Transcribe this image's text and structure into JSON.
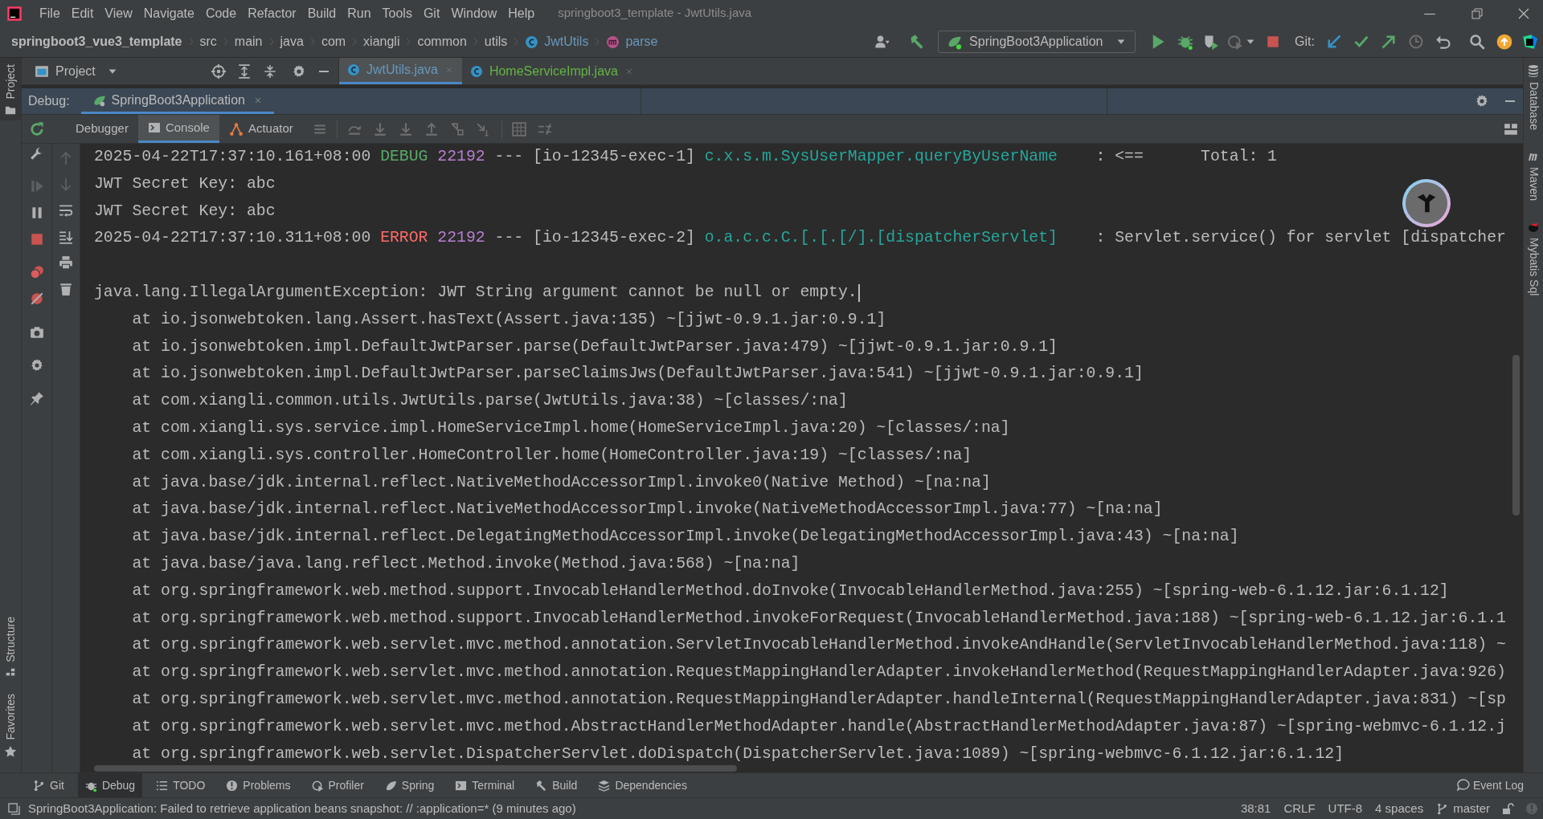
{
  "window": {
    "title": "springboot3_template - JwtUtils.java"
  },
  "menu": [
    "File",
    "Edit",
    "View",
    "Navigate",
    "Code",
    "Refactor",
    "Build",
    "Run",
    "Tools",
    "Git",
    "Window",
    "Help"
  ],
  "breadcrumbs": [
    {
      "label": "springboot3_vue3_template",
      "kind": "project"
    },
    {
      "label": "src",
      "kind": "folder"
    },
    {
      "label": "main",
      "kind": "folder"
    },
    {
      "label": "java",
      "kind": "folder"
    },
    {
      "label": "com",
      "kind": "folder"
    },
    {
      "label": "xiangli",
      "kind": "folder"
    },
    {
      "label": "common",
      "kind": "folder"
    },
    {
      "label": "utils",
      "kind": "folder"
    },
    {
      "label": "JwtUtils",
      "kind": "class"
    },
    {
      "label": "parse",
      "kind": "method"
    }
  ],
  "toolbar": {
    "run_config": "SpringBoot3Application",
    "git_label": "Git:"
  },
  "project_panel": {
    "title": "Project"
  },
  "editor_tabs": [
    {
      "label": "JwtUtils.java",
      "selected": true,
      "color": "#6897bb"
    },
    {
      "label": "HomeServiceImpl.java",
      "selected": false,
      "color": "#62b543"
    }
  ],
  "left_stripe": {
    "top": [
      "Project"
    ],
    "bottom": [
      "Structure",
      "Favorites"
    ]
  },
  "right_stripe": [
    "Database",
    "Maven",
    "Mybatis Sql"
  ],
  "debug": {
    "label": "Debug:",
    "sessions": [
      {
        "label": "SpringBoot3Application",
        "selected": true
      }
    ],
    "tabs": [
      {
        "label": "Debugger",
        "selected": false,
        "kind": "debugger"
      },
      {
        "label": "Console",
        "selected": true,
        "kind": "console"
      },
      {
        "label": "Actuator",
        "selected": false,
        "kind": "actuator"
      }
    ]
  },
  "console": {
    "lines": [
      {
        "kind": "log",
        "segments": [
          {
            "kind": "text",
            "text": "2025-04-22T17:37:10.161+08:00 "
          },
          {
            "kind": "debug",
            "text": "DEBUG"
          },
          {
            "kind": "pid",
            "text": " 22192"
          },
          {
            "kind": "text",
            "text": " --- [io-12345-exec-1] "
          },
          {
            "kind": "logger",
            "text": "c.x.s.m.SysUserMapper.queryByUserName"
          },
          {
            "kind": "text",
            "text": "    : <==      Total: 1"
          }
        ]
      },
      {
        "kind": "plain",
        "text": "JWT Secret Key: abc"
      },
      {
        "kind": "plain",
        "text": "JWT Secret Key: abc"
      },
      {
        "kind": "log",
        "segments": [
          {
            "kind": "text",
            "text": "2025-04-22T17:37:10.311+08:00 "
          },
          {
            "kind": "error",
            "text": "ERROR"
          },
          {
            "kind": "pid",
            "text": " 22192"
          },
          {
            "kind": "text",
            "text": " --- [io-12345-exec-2] "
          },
          {
            "kind": "logger",
            "text": "o.a.c.c.C.[.[.[/].[dispatcherServlet]"
          },
          {
            "kind": "text",
            "text": "    : Servlet.service() for servlet [dispatcher"
          }
        ]
      },
      {
        "kind": "blank"
      },
      {
        "kind": "plain",
        "text": "java.lang.IllegalArgumentException: JWT String argument cannot be null or empty.",
        "cursor": true
      },
      {
        "kind": "stack",
        "text": "at io.jsonwebtoken.lang.Assert.hasText(Assert.java:135) ~[jjwt-0.9.1.jar:0.9.1]"
      },
      {
        "kind": "stack",
        "text": "at io.jsonwebtoken.impl.DefaultJwtParser.parse(DefaultJwtParser.java:479) ~[jjwt-0.9.1.jar:0.9.1]"
      },
      {
        "kind": "stack",
        "text": "at io.jsonwebtoken.impl.DefaultJwtParser.parseClaimsJws(DefaultJwtParser.java:541) ~[jjwt-0.9.1.jar:0.9.1]"
      },
      {
        "kind": "stack",
        "text": "at com.xiangli.common.utils.JwtUtils.parse(JwtUtils.java:38) ~[classes/:na]"
      },
      {
        "kind": "stack",
        "text": "at com.xiangli.sys.service.impl.HomeServiceImpl.home(HomeServiceImpl.java:20) ~[classes/:na]"
      },
      {
        "kind": "stack",
        "text": "at com.xiangli.sys.controller.HomeController.home(HomeController.java:19) ~[classes/:na]"
      },
      {
        "kind": "stack",
        "text": "at java.base/jdk.internal.reflect.NativeMethodAccessorImpl.invoke0(Native Method) ~[na:na]"
      },
      {
        "kind": "stack",
        "text": "at java.base/jdk.internal.reflect.NativeMethodAccessorImpl.invoke(NativeMethodAccessorImpl.java:77) ~[na:na]"
      },
      {
        "kind": "stack",
        "text": "at java.base/jdk.internal.reflect.DelegatingMethodAccessorImpl.invoke(DelegatingMethodAccessorImpl.java:43) ~[na:na]"
      },
      {
        "kind": "stack",
        "text": "at java.base/java.lang.reflect.Method.invoke(Method.java:568) ~[na:na]"
      },
      {
        "kind": "stack",
        "text": "at org.springframework.web.method.support.InvocableHandlerMethod.doInvoke(InvocableHandlerMethod.java:255) ~[spring-web-6.1.12.jar:6.1.12]"
      },
      {
        "kind": "stack",
        "text": "at org.springframework.web.method.support.InvocableHandlerMethod.invokeForRequest(InvocableHandlerMethod.java:188) ~[spring-web-6.1.12.jar:6.1.1"
      },
      {
        "kind": "stack",
        "text": "at org.springframework.web.servlet.mvc.method.annotation.ServletInvocableHandlerMethod.invokeAndHandle(ServletInvocableHandlerMethod.java:118) ~"
      },
      {
        "kind": "stack",
        "text": "at org.springframework.web.servlet.mvc.method.annotation.RequestMappingHandlerAdapter.invokeHandlerMethod(RequestMappingHandlerAdapter.java:926)"
      },
      {
        "kind": "stack",
        "text": "at org.springframework.web.servlet.mvc.method.annotation.RequestMappingHandlerAdapter.handleInternal(RequestMappingHandlerAdapter.java:831) ~[sp"
      },
      {
        "kind": "stack",
        "text": "at org.springframework.web.servlet.mvc.method.AbstractHandlerMethodAdapter.handle(AbstractHandlerMethodAdapter.java:87) ~[spring-webmvc-6.1.12.j"
      },
      {
        "kind": "stack",
        "text": "at org.springframework.web.servlet.DispatcherServlet.doDispatch(DispatcherServlet.java:1089) ~[spring-webmvc-6.1.12.jar:6.1.12]"
      }
    ]
  },
  "tool_windows": [
    {
      "label": "Git",
      "selected": false,
      "kind": "git"
    },
    {
      "label": "Debug",
      "selected": true,
      "kind": "debug"
    },
    {
      "label": "TODO",
      "selected": false,
      "kind": "todo"
    },
    {
      "label": "Problems",
      "selected": false,
      "kind": "problems"
    },
    {
      "label": "Profiler",
      "selected": false,
      "kind": "profiler"
    },
    {
      "label": "Spring",
      "selected": false,
      "kind": "spring"
    },
    {
      "label": "Terminal",
      "selected": false,
      "kind": "terminal"
    },
    {
      "label": "Build",
      "selected": false,
      "kind": "build"
    },
    {
      "label": "Dependencies",
      "selected": false,
      "kind": "dependencies"
    }
  ],
  "event_log": "Event Log",
  "status_bar": {
    "message": "SpringBoot3Application: Failed to retrieve application beans snapshot: // :application=* (9 minutes ago)",
    "position": "38:81",
    "line_separator": "CRLF",
    "encoding": "UTF-8",
    "indent": "4 spaces",
    "branch": "master"
  }
}
